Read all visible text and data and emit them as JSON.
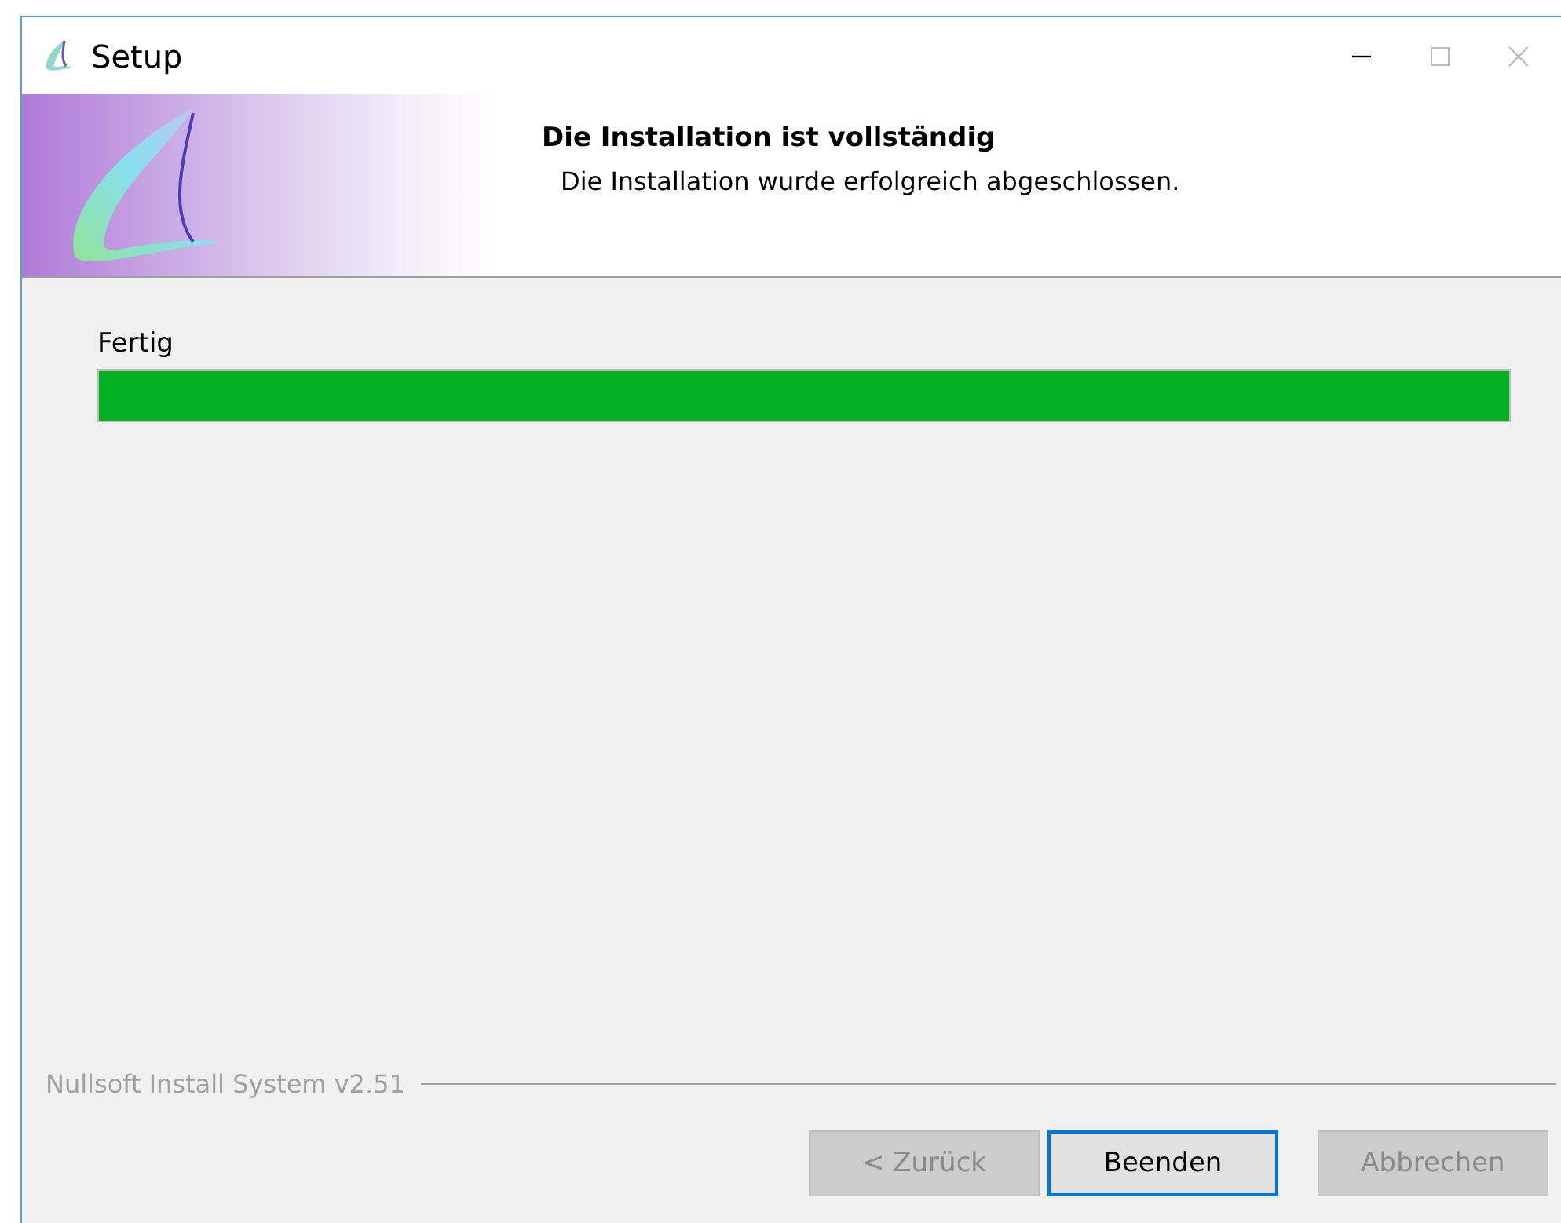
{
  "window": {
    "title": "Setup"
  },
  "header": {
    "title": "Die Installation ist vollständig",
    "subtitle": "Die Installation wurde erfolgreich abgeschlossen."
  },
  "progress": {
    "label": "Fertig",
    "level": 1
  },
  "branding": "Nullsoft Install System v2.51",
  "buttons": [
    {
      "label": "< Zurück",
      "disabled": true,
      "default": false
    },
    {
      "label": "Beenden",
      "disabled": false,
      "default": true
    },
    {
      "label": "Abbrechen",
      "disabled": true,
      "default": false
    }
  ]
}
